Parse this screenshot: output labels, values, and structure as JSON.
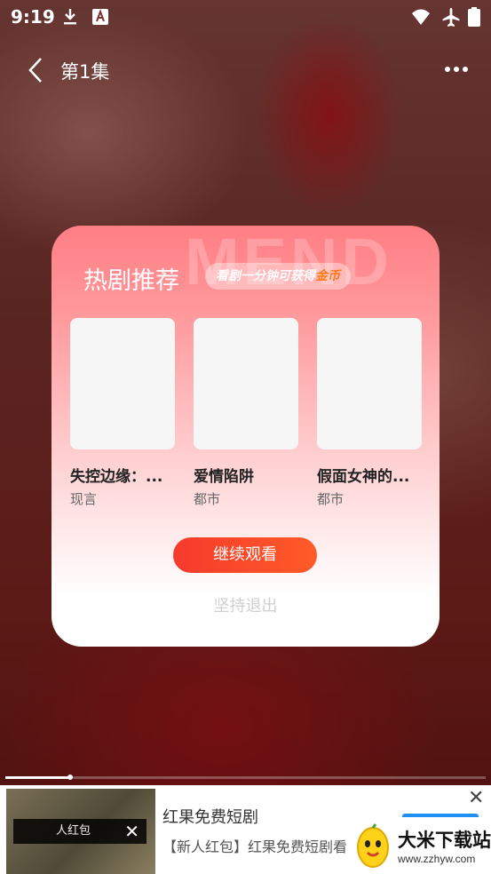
{
  "status_bar": {
    "time": "9:19",
    "icons": [
      "download-icon",
      "font-app-icon",
      "wifi-icon",
      "airplane-icon",
      "battery-icon"
    ]
  },
  "nav": {
    "back_icon": "chevron-left-icon",
    "episode_title": "第1集",
    "more_icon": "more-dots-icon"
  },
  "modal": {
    "watermark": "MEND",
    "title": "热剧推荐",
    "hint_prefix": "看剧一分钟可获得",
    "hint_highlight": "金币",
    "dramas": [
      {
        "title": "失控边缘：...",
        "genre": "现言"
      },
      {
        "title": "爱情陷阱",
        "genre": "都市"
      },
      {
        "title": "假面女神的...",
        "genre": "都市"
      }
    ],
    "continue_label": "继续观看",
    "quit_label": "坚持退出",
    "accent_color": "#f5402b"
  },
  "player": {
    "progress": 0.135
  },
  "ad": {
    "badge_text": "人红包",
    "title": "红果免费短剧",
    "description": "【新人红包】红果免费短剧看",
    "close_icon": "close-icon"
  },
  "brand": {
    "name": "大米下载站",
    "url": "www.zzhyw.com"
  }
}
